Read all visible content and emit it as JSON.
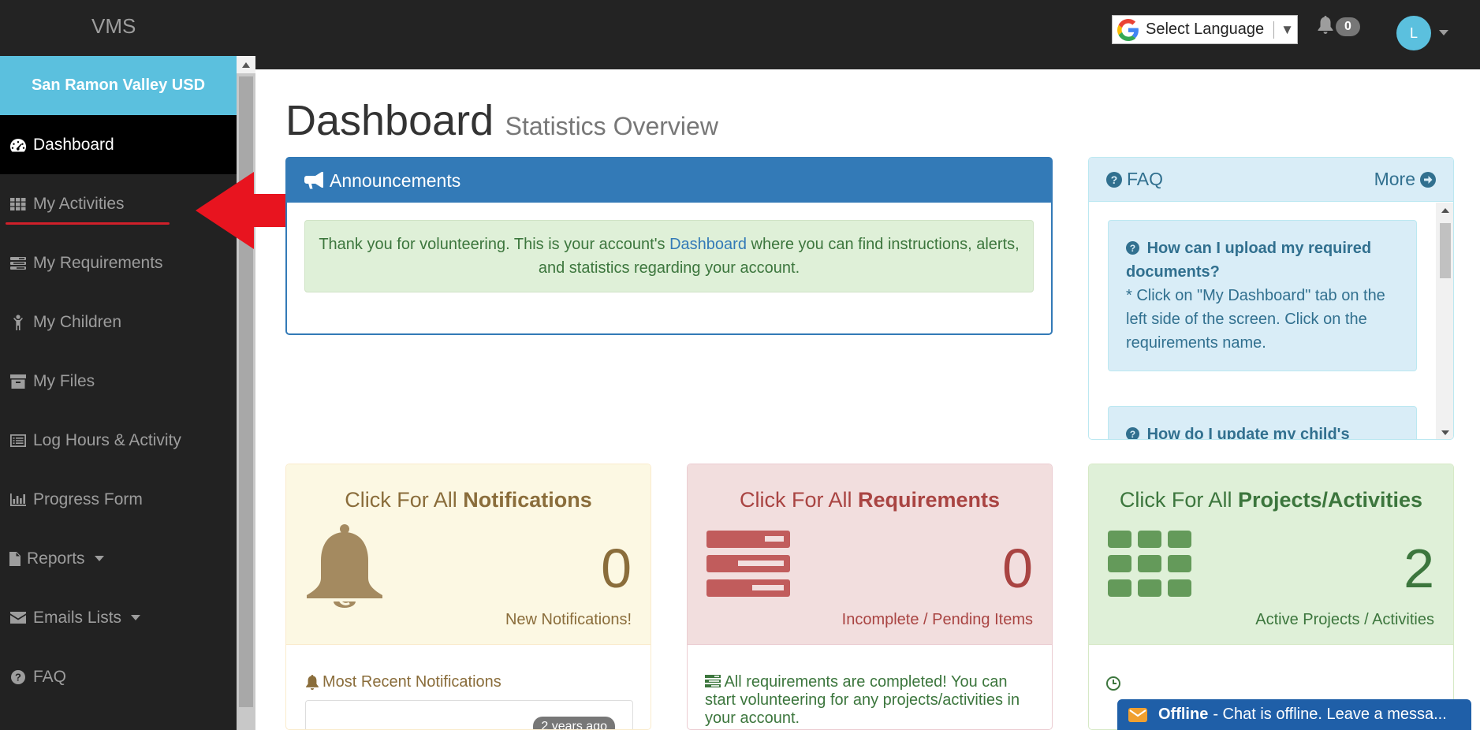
{
  "brand": "VMS",
  "topbar": {
    "translate_label": "Select Language",
    "notification_count": "0",
    "avatar_initial": "L"
  },
  "sidebar": {
    "org_name": "San Ramon Valley USD",
    "items": [
      {
        "label": "Dashboard",
        "icon": "dashboard-icon"
      },
      {
        "label": "My Activities",
        "icon": "grid-icon"
      },
      {
        "label": "My Requirements",
        "icon": "list-icon"
      },
      {
        "label": "My Children",
        "icon": "child-icon"
      },
      {
        "label": "My Files",
        "icon": "archive-icon"
      },
      {
        "label": "Log Hours & Activity",
        "icon": "list-alt-icon"
      },
      {
        "label": "Progress Form",
        "icon": "bar-chart-icon"
      },
      {
        "label": "Reports",
        "icon": "file-icon"
      },
      {
        "label": "Emails Lists",
        "icon": "envelope-icon"
      },
      {
        "label": "FAQ",
        "icon": "question-icon"
      }
    ]
  },
  "page": {
    "title": "Dashboard",
    "subtitle": "Statistics Overview"
  },
  "announcements": {
    "title": "Announcements",
    "text_before": "Thank you for volunteering. This is your account's ",
    "link": "Dashboard",
    "text_after": " where you can find instructions, alerts, and statistics regarding your account."
  },
  "faq": {
    "title": "FAQ",
    "more": "More",
    "items": [
      {
        "q": "How can I upload my required documents?",
        "a": "* Click on \"My Dashboard\" tab on the left side of the screen. Click on the requirements name."
      },
      {
        "q": "How do I update my child's",
        "a": ""
      }
    ]
  },
  "stats": {
    "notifications": {
      "prefix": "Click For All ",
      "bold": "Notifications",
      "count": "0",
      "caption": "New Notifications!",
      "recent_label": "Most Recent Notifications",
      "ago": "2 years ago"
    },
    "requirements": {
      "prefix": "Click For All ",
      "bold": "Requirements",
      "count": "0",
      "caption": "Incomplete / Pending Items",
      "message": "All requirements are completed! You can start volunteering for any projects/activities in your account."
    },
    "projects": {
      "prefix": "Click For All ",
      "bold": "Projects/Activities",
      "count": "2",
      "caption": "Active Projects / Activities"
    }
  },
  "chat": {
    "status": "Offline",
    "message": "- Chat is offline. Leave a messa..."
  },
  "colors": {
    "accent_blue": "#337ab7",
    "info": "#5bc0de",
    "arrow_red": "#e8141f"
  }
}
